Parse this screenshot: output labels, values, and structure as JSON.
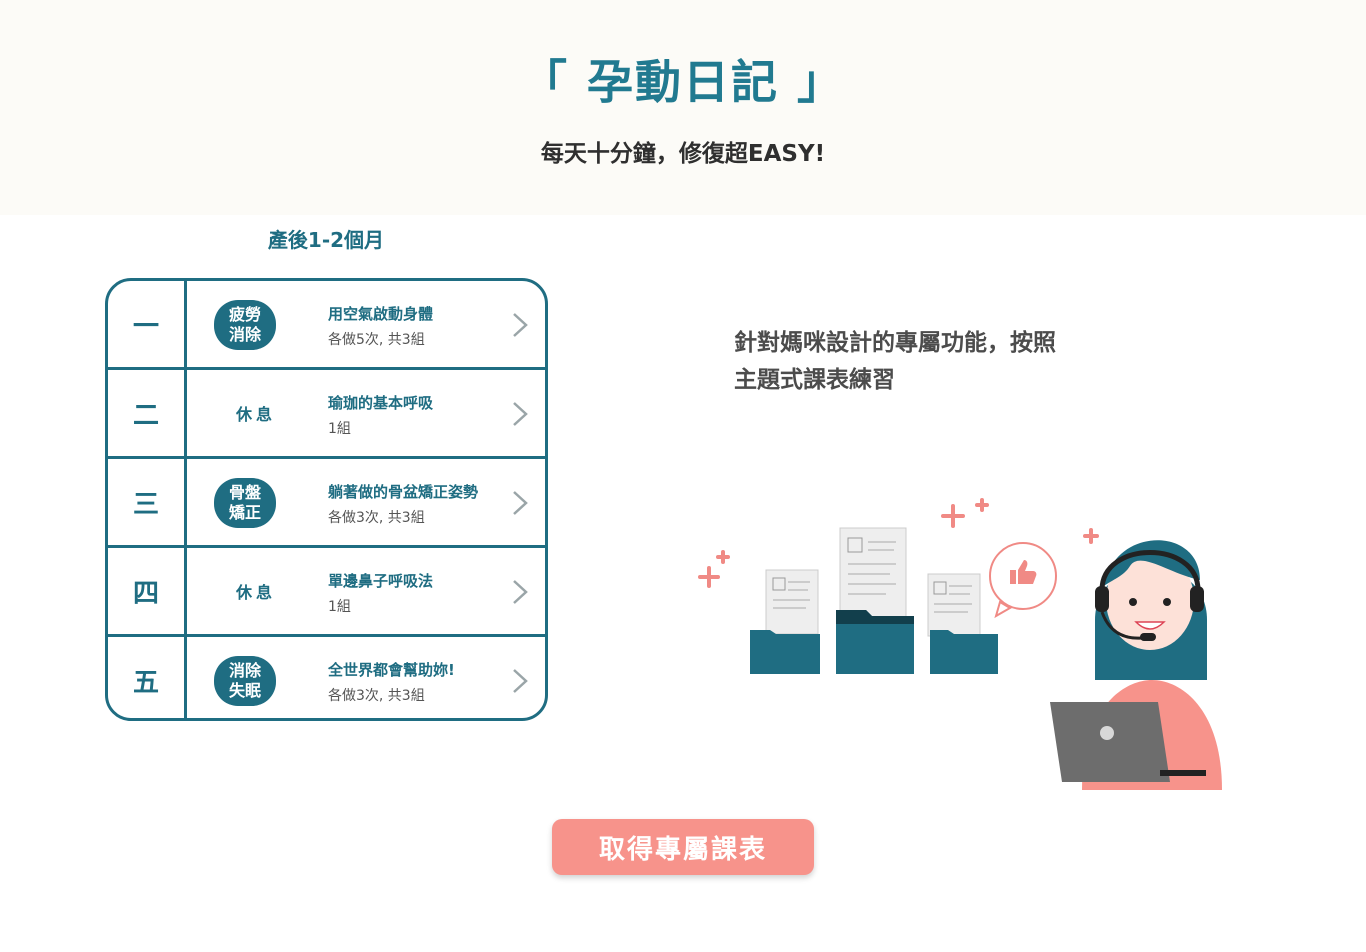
{
  "header": {
    "title": "「 孕動日記 」",
    "subtitle": "每天十分鐘，修復超EASY!"
  },
  "schedule": {
    "period": "產後1-2個月",
    "rows": [
      {
        "day": "一",
        "tag": "疲勞\n消除",
        "tag_type": "badge",
        "name": "用空氣啟動身體",
        "detail": "各做5次, 共3組"
      },
      {
        "day": "二",
        "tag": "休息",
        "tag_type": "rest",
        "name": "瑜珈的基本呼吸",
        "detail": "1組"
      },
      {
        "day": "三",
        "tag": "骨盤\n矯正",
        "tag_type": "badge",
        "name": "躺著做的骨盆矯正姿勢",
        "detail": "各做3次, 共3組"
      },
      {
        "day": "四",
        "tag": "休息",
        "tag_type": "rest",
        "name": "單邊鼻子呼吸法",
        "detail": "1組"
      },
      {
        "day": "五",
        "tag": "消除\n失眠",
        "tag_type": "badge",
        "name": "全世界都會幫助妳!",
        "detail": "各做3次, 共3組"
      }
    ]
  },
  "feature": {
    "description_line1": "針對媽咪設計的專屬功能，按照",
    "description_line2": "主題式課表練習"
  },
  "cta": {
    "label": "取得專屬課表"
  },
  "colors": {
    "primary": "#1f6d82",
    "accent": "#f7938b",
    "hero_bg": "#fcfbf7"
  }
}
